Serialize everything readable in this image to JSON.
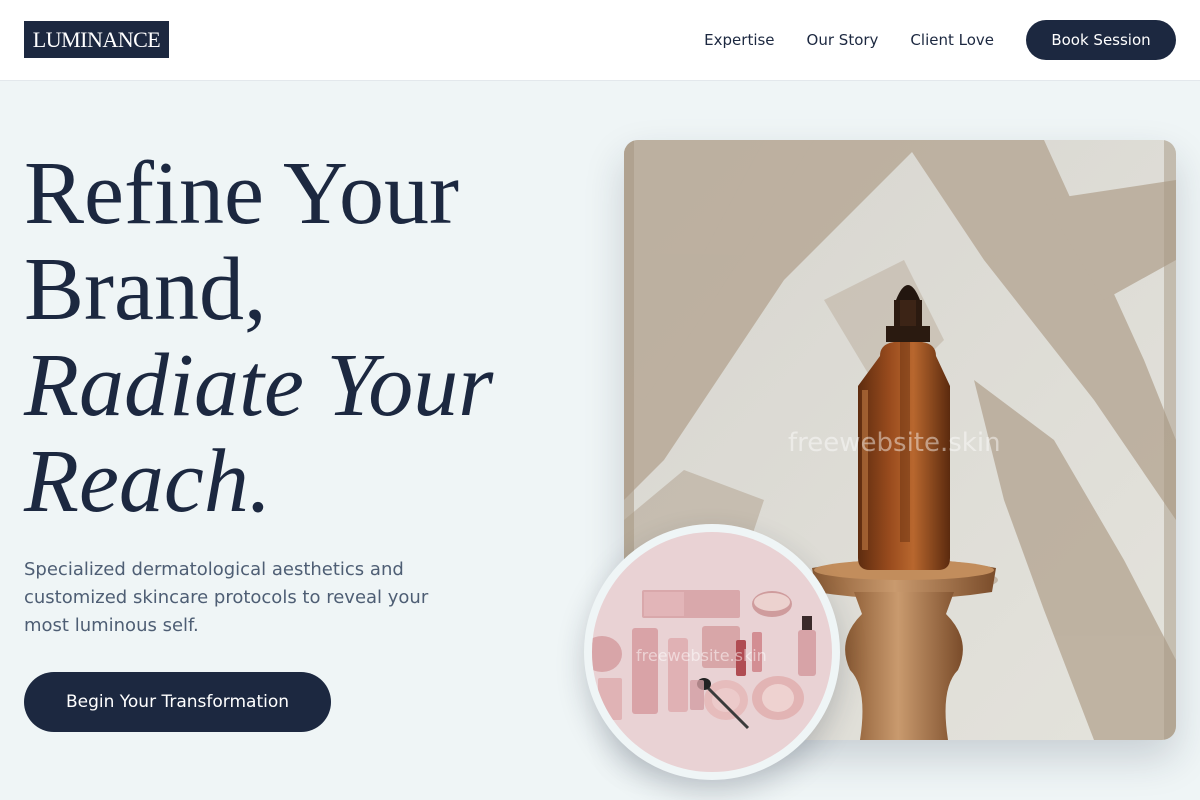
{
  "brand": {
    "logo_text": "LUMINANCE",
    "accent": "#1c2840",
    "background": "#eff5f6"
  },
  "nav": {
    "links": [
      "Expertise",
      "Our Story",
      "Client Love"
    ],
    "cta_label": "Book Session"
  },
  "hero": {
    "headline_lines": [
      "Refine Your",
      "Brand,"
    ],
    "headline_italic_lines": [
      "Radiate Your",
      "Reach."
    ],
    "subtext": "Specialized dermatological aesthetics and customized skincare protocols to reveal your most luminous self.",
    "cta_label": "Begin Your Transformation",
    "image_watermark": "freewebsite.skin",
    "circle_watermark": "freewebsite.skin"
  }
}
